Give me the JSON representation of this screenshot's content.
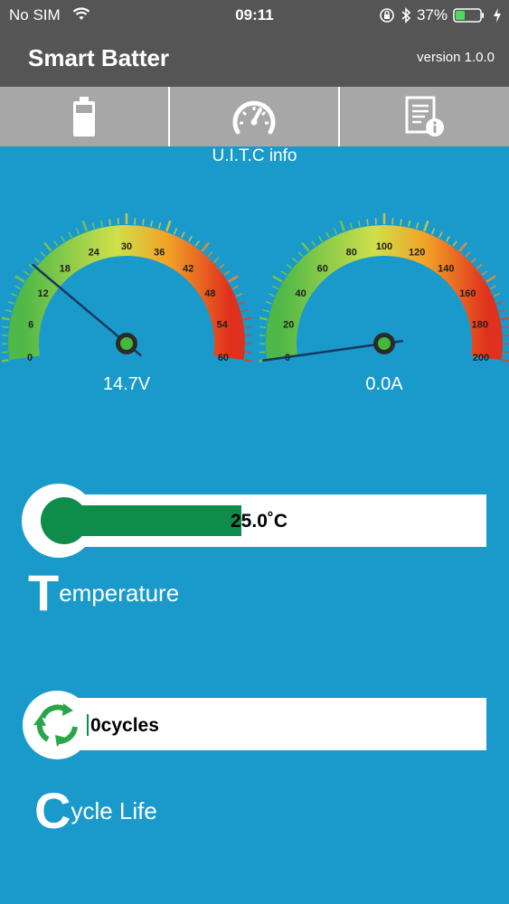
{
  "status_bar": {
    "carrier": "No SIM",
    "time": "09:11",
    "battery_percent": "37%"
  },
  "nav_bar": {
    "title": "Smart Batter",
    "version": "version 1.0.0"
  },
  "tabs": [
    {
      "icon": "battery-icon",
      "active": false
    },
    {
      "icon": "speedometer-icon",
      "active": true
    },
    {
      "icon": "info-document-icon",
      "active": false
    }
  ],
  "section_label": "U.I.T.C info",
  "voltage_gauge": {
    "ticks": [
      "0",
      "6",
      "12",
      "18",
      "24",
      "30",
      "36",
      "42",
      "48",
      "54",
      "60"
    ],
    "min": 0,
    "max": 60,
    "value": 14.7,
    "readout": "14.7V"
  },
  "current_gauge": {
    "ticks": [
      "0",
      "20",
      "40",
      "60",
      "80",
      "100",
      "120",
      "140",
      "160",
      "180",
      "200"
    ],
    "min": 0,
    "max": 200,
    "value": 0.0,
    "readout": "0.0A"
  },
  "temperature": {
    "value_text": "25.0˚C",
    "fill_fraction": 0.42,
    "caption_initial": "T",
    "caption_rest": "emperature"
  },
  "cycle_life": {
    "value_text": "0cycles",
    "caption_initial": "C",
    "caption_rest": "ycle Life"
  },
  "colors": {
    "background": "#1a9acb",
    "header": "#555555",
    "tab_bar": "#a7a7a7",
    "fill_green": "#0f8c4a",
    "status_battery_green": "#4cd964"
  }
}
